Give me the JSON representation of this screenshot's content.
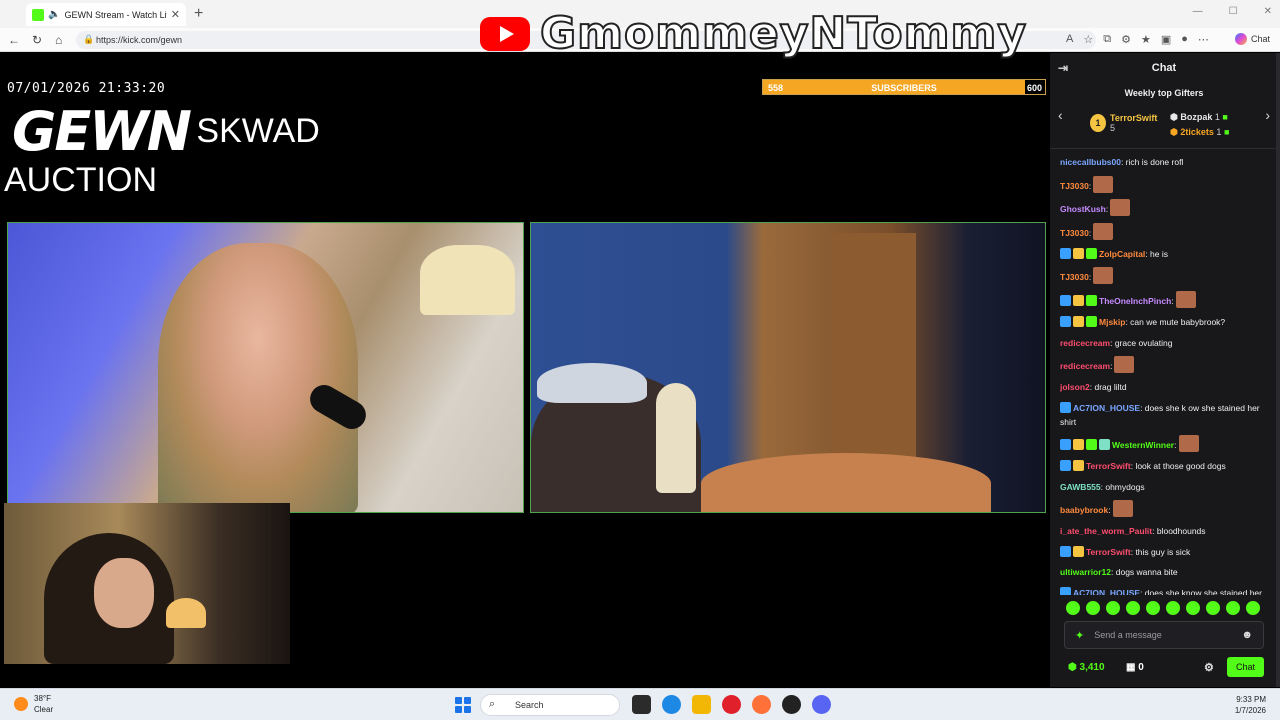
{
  "browser": {
    "tab_title": "GEWN Stream - Watch Live on Kick",
    "url": "https://kick.com/gewn",
    "copilot_label": "Chat"
  },
  "watermark": {
    "channel_name": "GmommeyNTommy"
  },
  "stream": {
    "datetime": "07/01/2026 21:33:20",
    "brand_main": "GEWN",
    "brand_sub": "SKWAD",
    "event_title": "AUCTION",
    "subgoal": {
      "current": "558",
      "label": "SUBSCRIBERS",
      "target": "600",
      "progress": 0.93,
      "color": "#f5a623"
    }
  },
  "chat": {
    "header": "Chat",
    "gifters_title": "Weekly top Gifters",
    "gifters": [
      {
        "rank": "1",
        "name": "TerrorSwift",
        "count": "5"
      },
      {
        "name": "Bozpak",
        "count": "1"
      },
      {
        "name": "2tickets",
        "count": "1"
      }
    ],
    "messages": [
      {
        "user": "nicecallbubs00",
        "color": "#7aa7ff",
        "text": ": rich is done rofl"
      },
      {
        "user": "TJ3030",
        "color": "#ff8a3d",
        "text": ":",
        "emote": true
      },
      {
        "user": "GhostKush",
        "color": "#c58bff",
        "text": ":",
        "emote": true
      },
      {
        "user": "TJ3030",
        "color": "#ff8a3d",
        "text": ":",
        "emote": true
      },
      {
        "user": "ZolpCapital",
        "color": "#ff8a3d",
        "text": ": he is",
        "badges": 3
      },
      {
        "user": "TJ3030",
        "color": "#ff8a3d",
        "text": ":",
        "emote": true
      },
      {
        "user": "TheOneInchPinch",
        "color": "#c58bff",
        "text": ":",
        "emote": true,
        "badges": 3
      },
      {
        "user": "Mjskip",
        "color": "#ff8a3d",
        "text": ": can we mute babybrook?",
        "badges": 3
      },
      {
        "user": "redicecream",
        "color": "#ff4d6d",
        "text": ": grace ovulating"
      },
      {
        "user": "redicecream",
        "color": "#ff4d6d",
        "text": ":",
        "emote": true
      },
      {
        "user": "jolson2",
        "color": "#ff4d6d",
        "text": ": drag liltd"
      },
      {
        "user": "AC7ION_HOUSE",
        "color": "#7aa7ff",
        "text": ": does she k ow she stained her shirt",
        "badges": 1
      },
      {
        "user": "WesternWinner",
        "color": "#53fc18",
        "text": ":",
        "emote": true,
        "badges": 4
      },
      {
        "user": "TerrorSwift",
        "color": "#ff4d6d",
        "text": ": look at those good dogs",
        "badges": 2
      },
      {
        "user": "GAWB555",
        "color": "#7ee0c4",
        "text": ": ohmydogs"
      },
      {
        "user": "baabybrook",
        "color": "#ff8a3d",
        "text": ":",
        "emote": true
      },
      {
        "user": "i_ate_the_worm_Paulit",
        "color": "#ff4d6d",
        "text": ": bloodhounds"
      },
      {
        "user": "TerrorSwift",
        "color": "#ff4d6d",
        "text": ": this guy is sick",
        "badges": 2
      },
      {
        "user": "ultiwarrior12",
        "color": "#53fc18",
        "text": ": dogs wanna bite"
      },
      {
        "user": "AC7ION_HOUSE",
        "color": "#7aa7ff",
        "text": ": does she know she stained her shirt",
        "badges": 1
      }
    ],
    "input_placeholder": "Send a message",
    "points": "3,410",
    "viewers_icon_count": "0",
    "send_label": "Chat",
    "accent": "#53fc18"
  },
  "taskbar": {
    "temperature": "38°F",
    "condition": "Clear",
    "search_label": "Search",
    "time": "9:33 PM",
    "date": "1/7/2026"
  }
}
